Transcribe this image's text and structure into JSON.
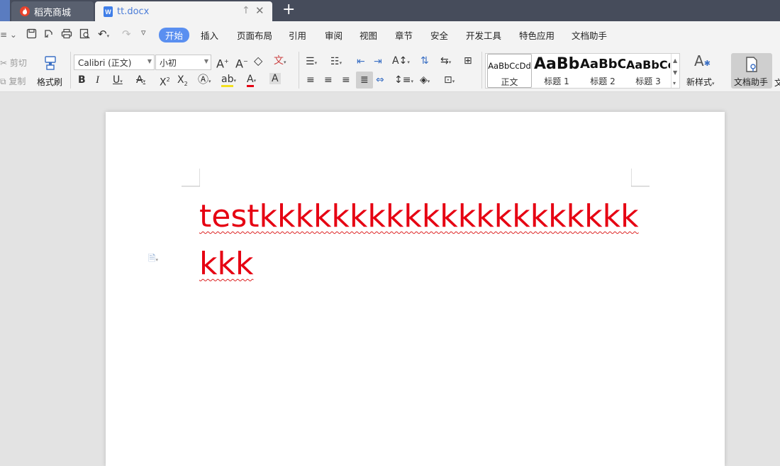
{
  "titlebar": {
    "tabs": [
      {
        "label": "稻壳商城",
        "icon": "daoke-flame-icon"
      },
      {
        "label": "tt.docx",
        "icon": "wps-writer-icon"
      }
    ]
  },
  "menu": {
    "items": [
      "开始",
      "插入",
      "页面布局",
      "引用",
      "审阅",
      "视图",
      "章节",
      "安全",
      "开发工具",
      "特色应用",
      "文档助手"
    ],
    "active": "开始"
  },
  "ribbon": {
    "clipboard": {
      "cut": "剪切",
      "copy": "复制",
      "format_painter": "格式刷"
    },
    "font": {
      "name": "Calibri (正文)",
      "size": "小初"
    },
    "styles": [
      {
        "sample": "AaBbCcDd",
        "name": "正文"
      },
      {
        "sample": "AaBb",
        "name": "标题 1"
      },
      {
        "sample": "AaBbC",
        "name": "标题 2"
      },
      {
        "sample": "AaBbCc",
        "name": "标题 3"
      }
    ],
    "new_style": "新样式",
    "doc_assistant": "文档助手",
    "overflow_label": "文"
  },
  "document": {
    "content": "testkkkkkkkkkkkkkkkkkkkkkkkk",
    "text_color": "#e60012"
  },
  "colors": {
    "titlebar": "#464c5b",
    "accent": "#5a8ff0",
    "ribbon_bg": "#f3f3f3"
  }
}
